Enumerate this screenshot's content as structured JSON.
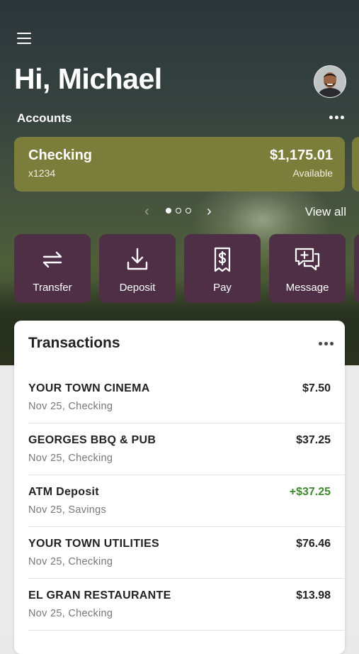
{
  "header": {
    "greeting": "Hi, Michael",
    "menu_icon": "hamburger-menu-icon",
    "avatar_icon": "user-avatar"
  },
  "accounts": {
    "section_label": "Accounts",
    "more_icon": "more-horizontal-icon",
    "cards": [
      {
        "name": "Checking",
        "number": "x1234",
        "balance": "$1,175.01",
        "balance_label": "Available",
        "color": "#7b7d3b"
      }
    ],
    "pager": {
      "current_page": 1,
      "total_pages": 3
    },
    "view_all_label": "View all"
  },
  "actions": [
    {
      "label": "Transfer",
      "icon": "transfer-arrows-icon"
    },
    {
      "label": "Deposit",
      "icon": "download-tray-icon"
    },
    {
      "label": "Pay",
      "icon": "dollar-receipt-icon"
    },
    {
      "label": "Message",
      "icon": "chat-plus-icon"
    }
  ],
  "transactions": {
    "title": "Transactions",
    "more_icon": "more-horizontal-icon",
    "items": [
      {
        "name": "YOUR TOWN CINEMA",
        "detail": "Nov 25, Checking",
        "amount": "$7.50",
        "type": "debit"
      },
      {
        "name": "GEORGES BBQ & PUB",
        "detail": "Nov 25, Checking",
        "amount": "$37.25",
        "type": "debit"
      },
      {
        "name": "ATM Deposit",
        "detail": "Nov 25, Savings",
        "amount": "+$37.25",
        "type": "credit"
      },
      {
        "name": "YOUR TOWN UTILITIES",
        "detail": "Nov 25, Checking",
        "amount": "$76.46",
        "type": "debit"
      },
      {
        "name": "EL GRAN RESTAURANTE",
        "detail": "Nov 25, Checking",
        "amount": "$13.98",
        "type": "debit"
      }
    ]
  },
  "colors": {
    "action_button": "#4e2f45",
    "account_card": "#7b7d3b",
    "credit_amount": "#3c8a2e"
  }
}
